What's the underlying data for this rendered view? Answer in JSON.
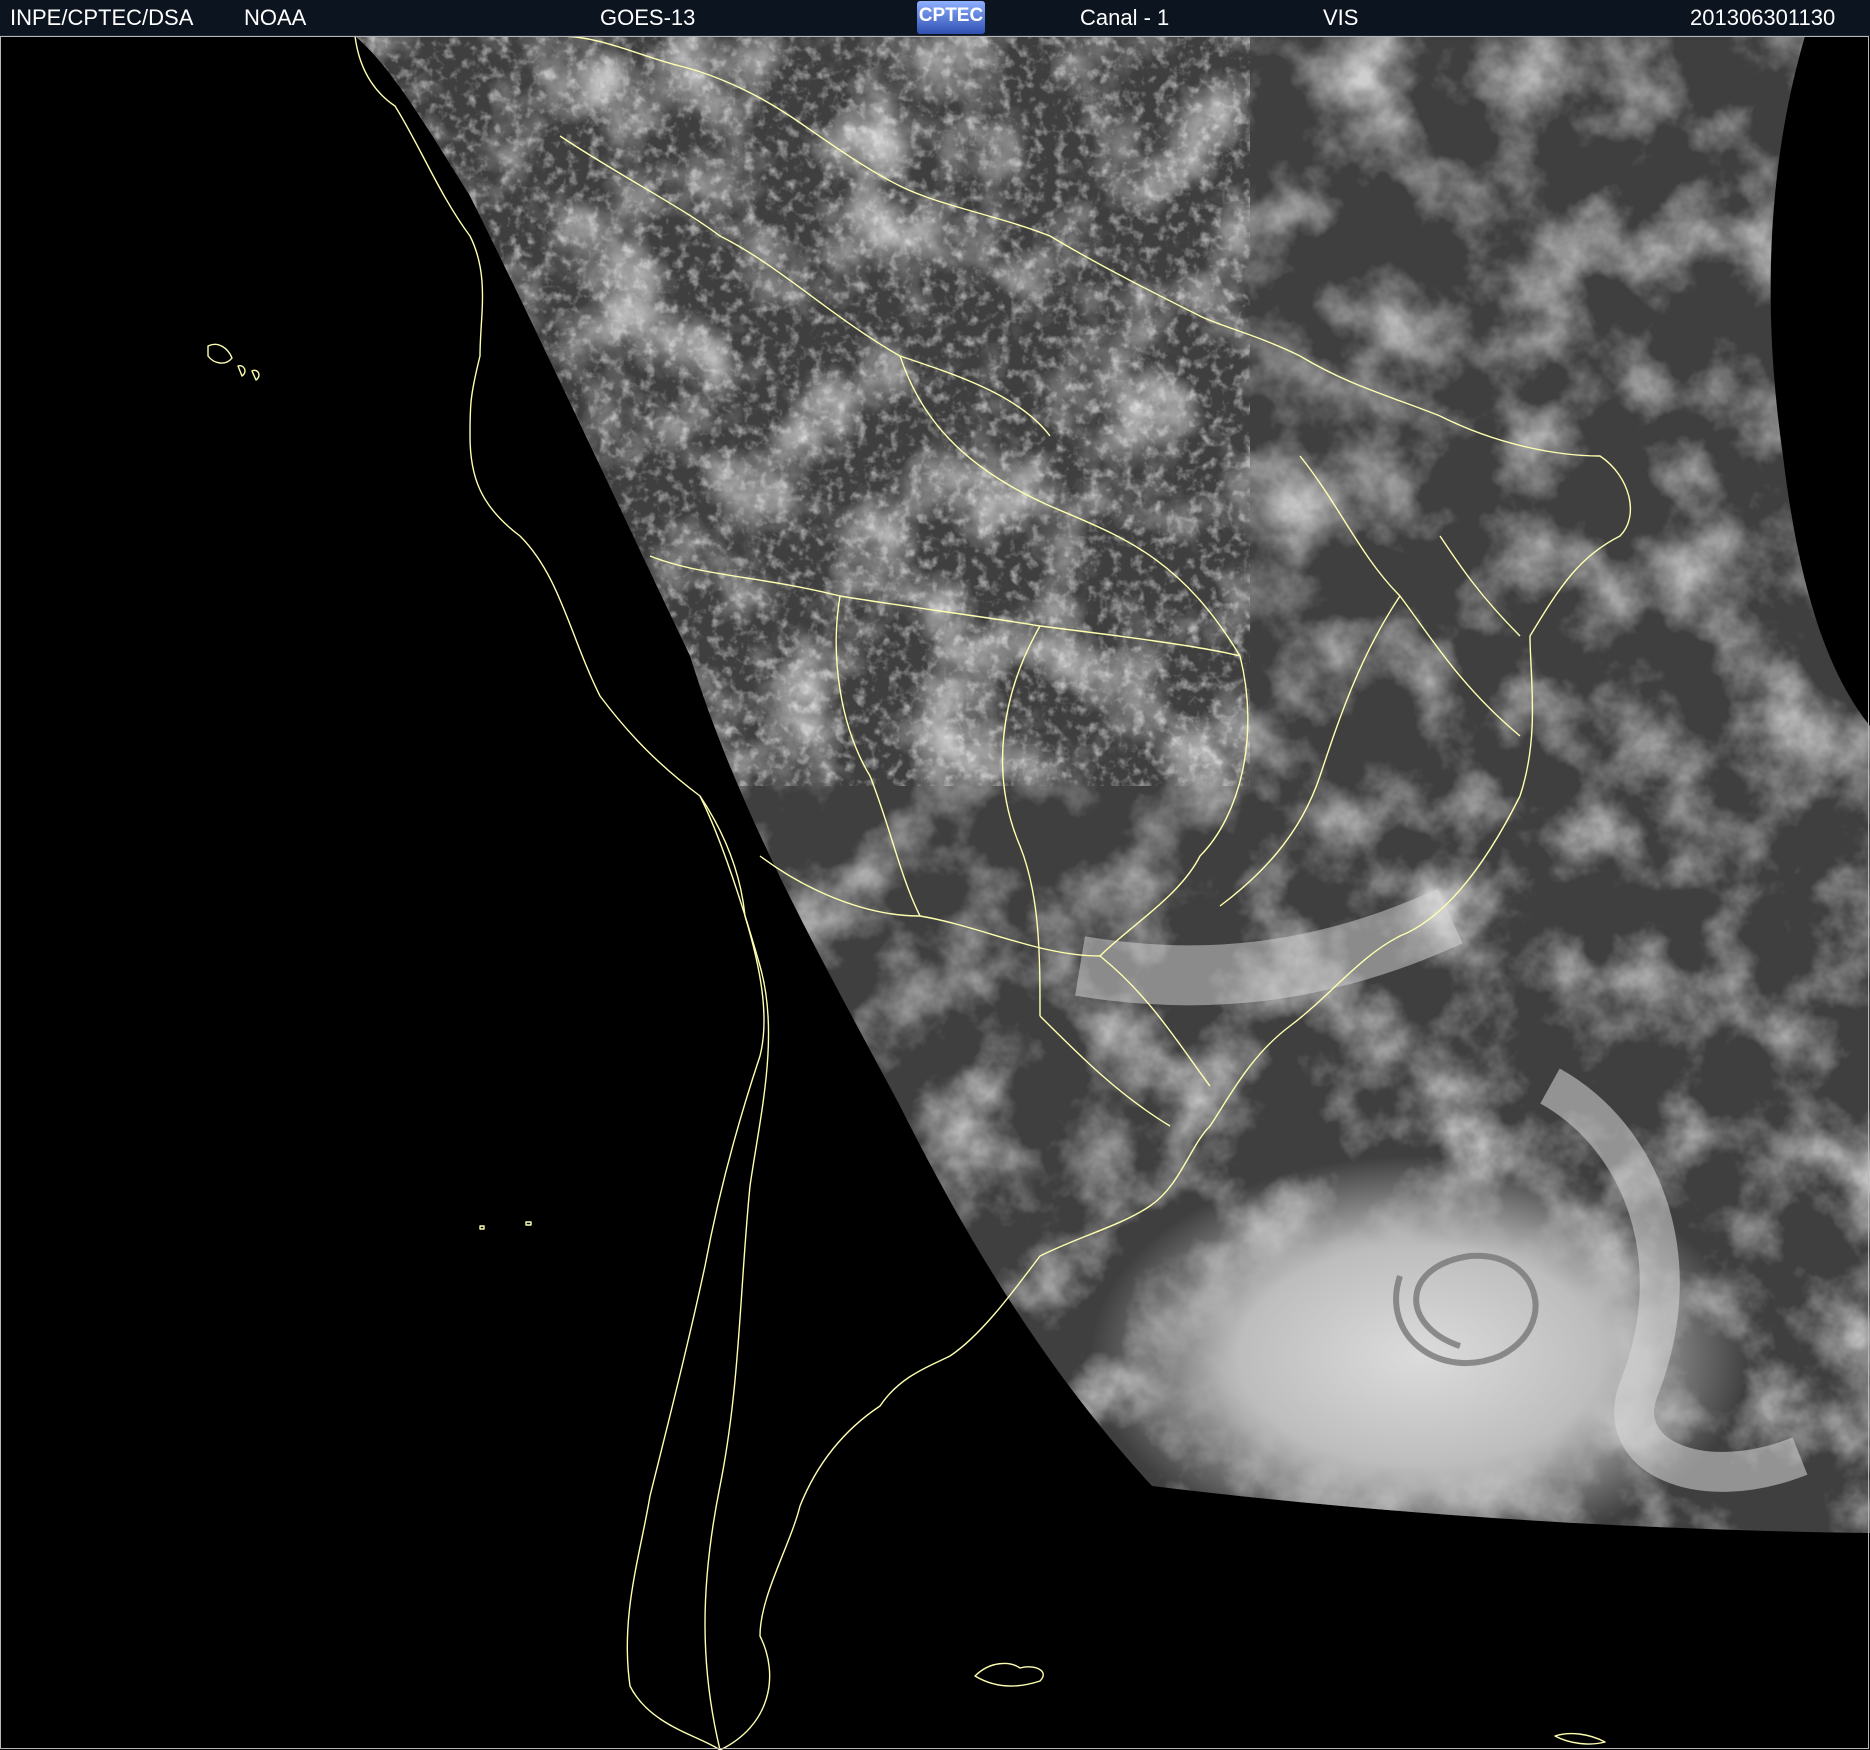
{
  "header": {
    "agency": "INPE/CPTEC/DSA",
    "source": "NOAA",
    "satellite": "GOES-13",
    "logo_text": "CPTEC",
    "channel": "Canal - 1",
    "band": "VIS",
    "timestamp": "201306301130"
  },
  "map": {
    "region": "South America",
    "imagery": "visible satellite cloud imagery",
    "boundary_color": "#ffffb0",
    "space_color": "#000000"
  }
}
